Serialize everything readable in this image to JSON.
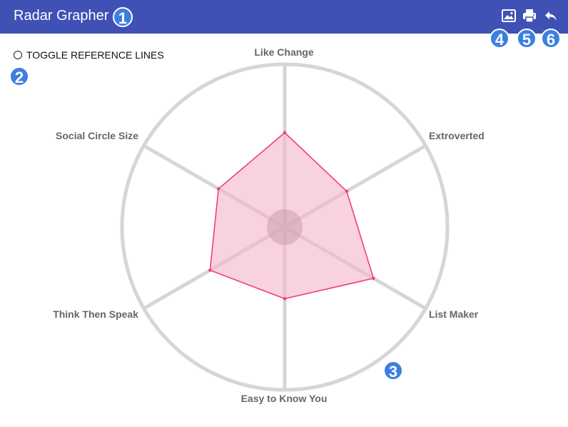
{
  "app": {
    "title": "Radar Grapher"
  },
  "header": {
    "icons": [
      "image-icon",
      "print-icon",
      "reply-icon"
    ]
  },
  "toggle": {
    "label": "TOGGLE REFERENCE LINES",
    "checked": false
  },
  "badges": [
    "1",
    "2",
    "3",
    "4",
    "5",
    "6"
  ],
  "colors": {
    "header": "#3f51b5",
    "badge": "#3d7fe0",
    "series_stroke": "#f0407a",
    "series_fill": "#f5b6cc",
    "grid": "#d6d6d6"
  },
  "chart_data": {
    "type": "radar",
    "axes": [
      "Like Change",
      "Extroverted",
      "List Maker",
      "Easy to Know You",
      "Think Then Speak",
      "Social Circle Size"
    ],
    "series": [
      {
        "values": [
          0.58,
          0.44,
          0.63,
          0.44,
          0.53,
          0.47
        ]
      }
    ],
    "range": [
      0,
      1
    ]
  }
}
